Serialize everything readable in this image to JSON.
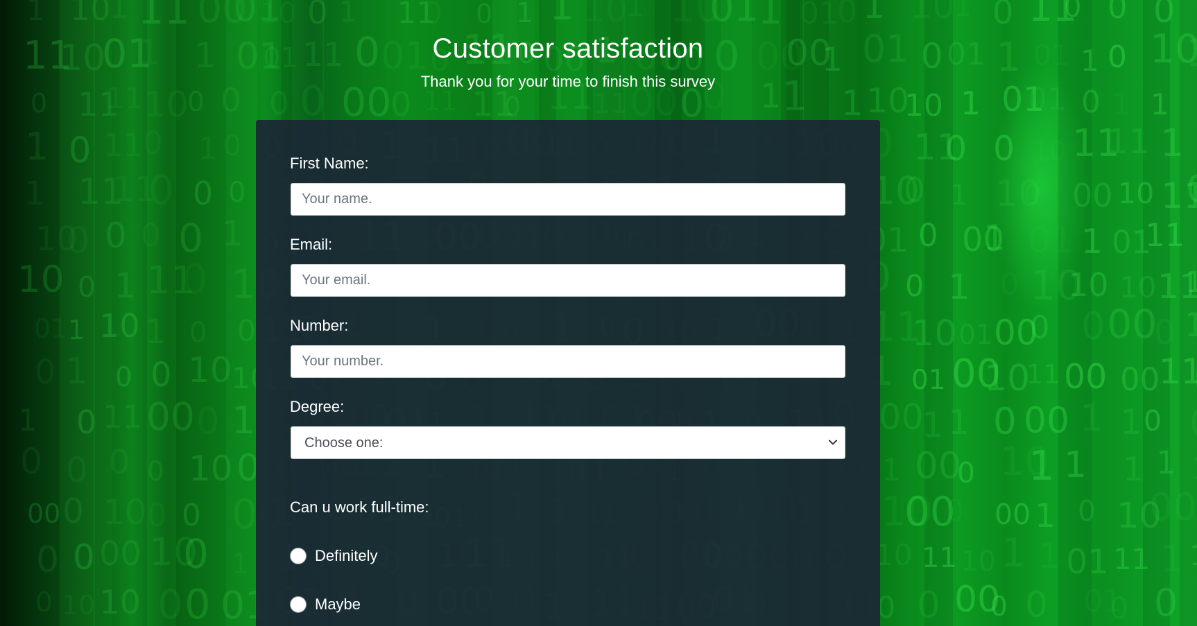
{
  "page": {
    "title": "Customer satisfaction",
    "subtitle": "Thank you for your time to finish this survey"
  },
  "form": {
    "first_name": {
      "label": "First Name:",
      "placeholder": "Your name."
    },
    "email": {
      "label": "Email:",
      "placeholder": "Your email."
    },
    "number": {
      "label": "Number:",
      "placeholder": "Your number."
    },
    "degree": {
      "label": "Degree:",
      "selected": "Choose one:"
    },
    "fulltime": {
      "label": "Can u work full-time:",
      "options": [
        "Definitely",
        "Maybe"
      ]
    }
  },
  "background": {
    "theme": "green binary digits",
    "glyphs": [
      "0",
      "1"
    ]
  }
}
